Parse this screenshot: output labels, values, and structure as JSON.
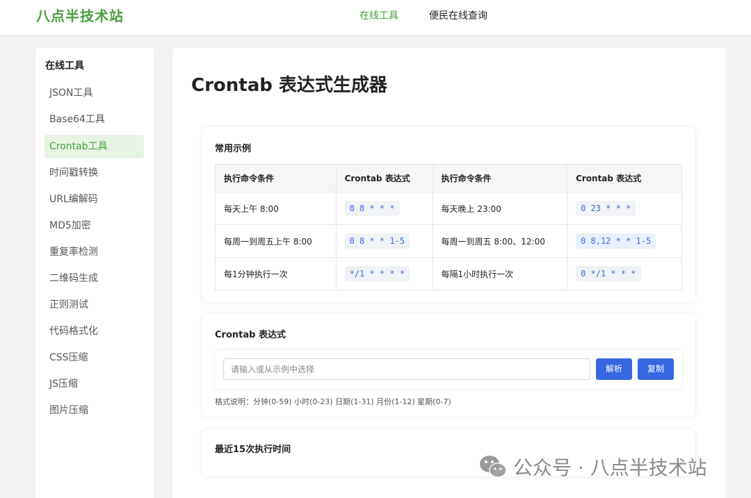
{
  "brand": {
    "name": "八点半技术站",
    "color": "#4a9e3f"
  },
  "nav": [
    {
      "label": "在线工具",
      "active": true
    },
    {
      "label": "便民在线查询",
      "active": false
    }
  ],
  "sidebar": {
    "title": "在线工具",
    "items": [
      {
        "label": "JSON工具"
      },
      {
        "label": "Base64工具"
      },
      {
        "label": "Crontab工具",
        "active": true
      },
      {
        "label": "时间戳转换"
      },
      {
        "label": "URL编解码"
      },
      {
        "label": "MD5加密"
      },
      {
        "label": "重复率检测"
      },
      {
        "label": "二维码生成"
      },
      {
        "label": "正则测试"
      },
      {
        "label": "代码格式化"
      },
      {
        "label": "CSS压缩"
      },
      {
        "label": "JS压缩"
      },
      {
        "label": "图片压缩"
      }
    ]
  },
  "main": {
    "title": "Crontab 表达式生成器",
    "examples": {
      "title": "常用示例",
      "headers": [
        "执行命令条件",
        "Crontab 表达式",
        "执行命令条件",
        "Crontab 表达式"
      ],
      "rows": [
        [
          "每天上午 8:00",
          "0 8 * * *",
          "每天晚上 23:00",
          "0 23 * * *"
        ],
        [
          "每周一到周五上午 8:00",
          "0 8 * * 1-5",
          "每周一到周五 8:00、12:00",
          "0 8,12 * * 1-5"
        ],
        [
          "每1分钟执行一次",
          "*/1 * * * *",
          "每隔1小时执行一次",
          "0 */1 * * *"
        ]
      ]
    },
    "expression": {
      "title": "Crontab 表达式",
      "placeholder": "请输入或从示例中选择",
      "parse_label": "解析",
      "copy_label": "复制",
      "hint": "格式说明：分钟(0-59) 小时(0-23) 日期(1-31) 月份(1-12) 星期(0-7)"
    },
    "recent": {
      "title": "最近15次执行时间"
    }
  },
  "watermark": {
    "text": "公众号 · 八点半技术站",
    "icon": "wechat-icon"
  },
  "colors": {
    "accent": "#4a9e3f",
    "button": "#3667e0",
    "code": "#3b6fd6"
  }
}
